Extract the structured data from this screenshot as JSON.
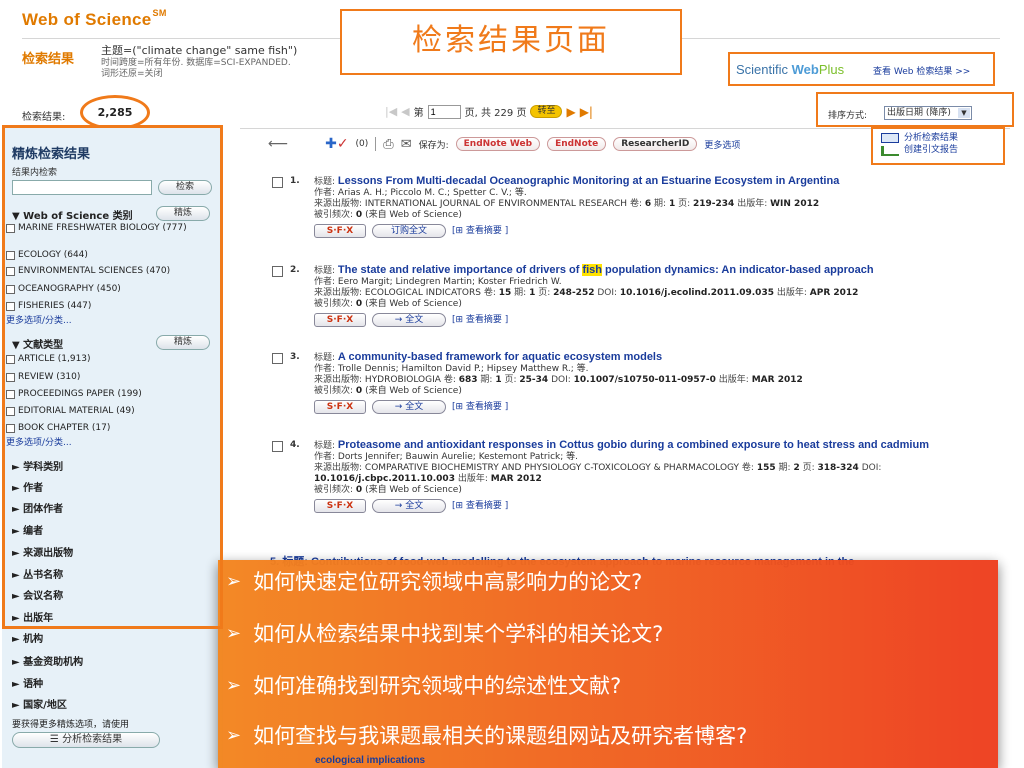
{
  "header": {
    "brand": "Web of Science",
    "brand_mark": "SM",
    "results_label": "检索结果",
    "query": "主题=(\"climate change\" same fish\")",
    "query_sub1": "时间跨度=所有年份. 数据库=SCI-EXPANDED.",
    "query_sub2": "词形还原=关闭",
    "callout_title": "检索结果页面",
    "webplus_logo_a": "Scientific ",
    "webplus_logo_b": "Web",
    "webplus_logo_c": "Plus",
    "webplus_link": "查看 Web 检索结果 >>"
  },
  "results_bar": {
    "count_label": "检索结果:",
    "count": "2,285",
    "page_prefix": "第",
    "page_value": "1",
    "page_suffix": "页, 共 229 页",
    "go": "转至",
    "sort_label": "排序方式:",
    "sort_value": "出版日期 (降序)"
  },
  "sidebar": {
    "title": "精炼检索结果",
    "within_label": "结果内检索",
    "search_btn": "检索",
    "facet1": {
      "title": "Web of Science 类别",
      "refine": "精炼",
      "items": [
        "MARINE FRESHWATER BIOLOGY (777)",
        "ECOLOGY (644)",
        "ENVIRONMENTAL SCIENCES (470)",
        "OCEANOGRAPHY (450)",
        "FISHERIES (447)"
      ],
      "more": "更多选项/分类..."
    },
    "facet2": {
      "title": "文献类型",
      "refine": "精炼",
      "items": [
        "ARTICLE (1,913)",
        "REVIEW (310)",
        "PROCEEDINGS PAPER (199)",
        "EDITORIAL MATERIAL (49)",
        "BOOK CHAPTER (17)"
      ],
      "more": "更多选项/分类..."
    },
    "collapsed": [
      "学科类别",
      "作者",
      "团体作者",
      "编者",
      "来源出版物",
      "丛书名称",
      "会议名称",
      "出版年",
      "机构",
      "基金资助机构",
      "语种",
      "国家/地区"
    ],
    "note": "要获得更多精炼选项，请使用",
    "analyze_btn": "分析检索结果"
  },
  "toolbar": {
    "marked": "(0)",
    "save_as": "保存为:",
    "endnote_web": "EndNote Web",
    "endnote": "EndNote",
    "researcherid": "ResearcherID",
    "more": "更多选项",
    "analyze": "分析检索结果",
    "citation_report": "创建引文报告"
  },
  "labels": {
    "title": "标题:",
    "author": "作者:",
    "source": "来源出版物:",
    "cited": "被引频次:",
    "cited_suffix": "(来自 Web of Science)",
    "sfx": "S·F·X",
    "buy": "订购全文",
    "fulltext": "→ 全文",
    "abstract": "[⊞ 查看摘要 ]",
    "volume": "卷:",
    "issue": "期:",
    "pages": "页:",
    "pubyear": "出版年:",
    "doi": "DOI:"
  },
  "records": [
    {
      "num": "1.",
      "title": "Lessons From Multi-decadal Oceanographic Monitoring at an Estuarine Ecosystem in Argentina",
      "authors": "Arias A. H.; Piccolo M. C.; Spetter C. V.; 等.",
      "source": "INTERNATIONAL JOURNAL OF ENVIRONMENTAL RESEARCH",
      "vol": "6",
      "issue": "1",
      "pages": "219-234",
      "doi": "",
      "year": "WIN 2012",
      "cited": "0"
    },
    {
      "num": "2.",
      "title_a": "The state and relative importance of drivers of ",
      "title_hl": "fish",
      "title_b": " population dynamics: An indicator-based approach",
      "authors": "Eero Margit; Lindegren Martin; Koster Friedrich W.",
      "source": "ECOLOGICAL INDICATORS",
      "vol": "15",
      "issue": "1",
      "pages": "248-252",
      "doi": "10.1016/j.ecolind.2011.09.035",
      "year": "APR 2012",
      "cited": "0"
    },
    {
      "num": "3.",
      "title": "A community-based framework for aquatic ecosystem models",
      "authors": "Trolle Dennis; Hamilton David P.; Hipsey Matthew R.; 等.",
      "source": "HYDROBIOLOGIA",
      "vol": "683",
      "issue": "1",
      "pages": "25-34",
      "doi": "10.1007/s10750-011-0957-0",
      "year": "MAR 2012",
      "cited": "0"
    },
    {
      "num": "4.",
      "title": "Proteasome and antioxidant responses in Cottus gobio during a combined exposure to heat stress and cadmium",
      "authors": "Dorts Jennifer; Bauwin Aurelie; Kestemont Patrick; 等.",
      "source": "COMPARATIVE BIOCHEMISTRY AND PHYSIOLOGY C-TOXICOLOGY & PHARMACOLOGY",
      "vol": "155",
      "issue": "2",
      "pages": "318-324",
      "doi": "10.1016/j.cbpc.2011.10.003",
      "year": "MAR 2012",
      "cited": "0"
    }
  ],
  "peek": {
    "rec5": "5.   标题: Contributions of food-web modelling to the ecosystem approach to marine resource management in the",
    "tail": "ecological implications"
  },
  "questions": [
    "如何快速定位研究领域中高影响力的论文?",
    "如何从检索结果中找到某个学科的相关论文?",
    "如何准确找到研究领域中的综述性文献?",
    "如何查找与我课题最相关的课题组网站及研究者博客?"
  ],
  "colors": {
    "accent": "#f07a1a",
    "brand": "#e07a00",
    "link": "#1a3c9c",
    "sidebar": "#e7f1f8"
  }
}
